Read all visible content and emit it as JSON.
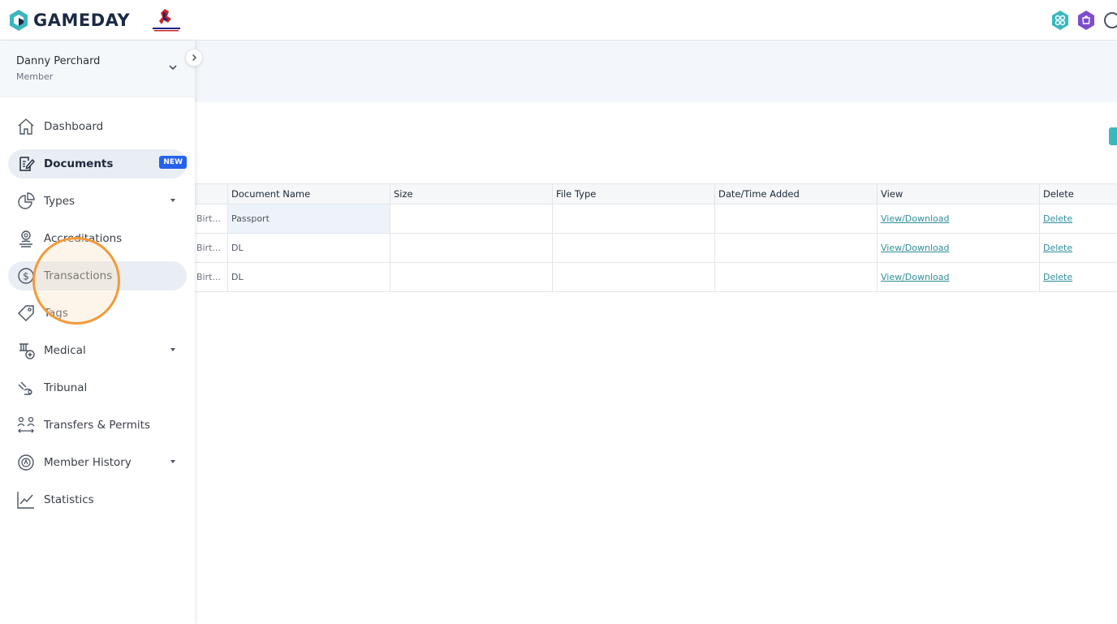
{
  "brand": {
    "name": "GAMEDAY",
    "accent": "#3ab7bf"
  },
  "user": {
    "name": "Danny Perchard",
    "role": "Member"
  },
  "nav": [
    {
      "label": "Dashboard",
      "icon": "home-icon"
    },
    {
      "label": "Documents",
      "icon": "document-edit-icon",
      "badge": "NEW",
      "active": true
    },
    {
      "label": "Types",
      "icon": "pie-chart-icon",
      "caret": true
    },
    {
      "label": "Accreditations",
      "icon": "accreditation-icon"
    },
    {
      "label": "Transactions",
      "icon": "dollar-circle-icon",
      "hover": true
    },
    {
      "label": "Tags",
      "icon": "tag-icon"
    },
    {
      "label": "Medical",
      "icon": "medical-icon",
      "caret": true
    },
    {
      "label": "Tribunal",
      "icon": "tribunal-icon"
    },
    {
      "label": "Transfers & Permits",
      "icon": "transfer-icon"
    },
    {
      "label": "Member History",
      "icon": "history-icon",
      "caret": true
    },
    {
      "label": "Statistics",
      "icon": "statistics-icon"
    }
  ],
  "table": {
    "columns": [
      "",
      "Document Name",
      "Size",
      "File Type",
      "Date/Time Added",
      "View",
      "Delete"
    ],
    "rows": [
      {
        "type": "Birt...",
        "name": "Passport",
        "size": "",
        "file_type": "",
        "added": "",
        "view": "View/Download",
        "delete": "Delete"
      },
      {
        "type": "Birt...",
        "name": "DL",
        "size": "",
        "file_type": "",
        "added": "",
        "view": "View/Download",
        "delete": "Delete"
      },
      {
        "type": "Birt...",
        "name": "DL",
        "size": "",
        "file_type": "",
        "added": "",
        "view": "View/Download",
        "delete": "Delete"
      }
    ]
  }
}
